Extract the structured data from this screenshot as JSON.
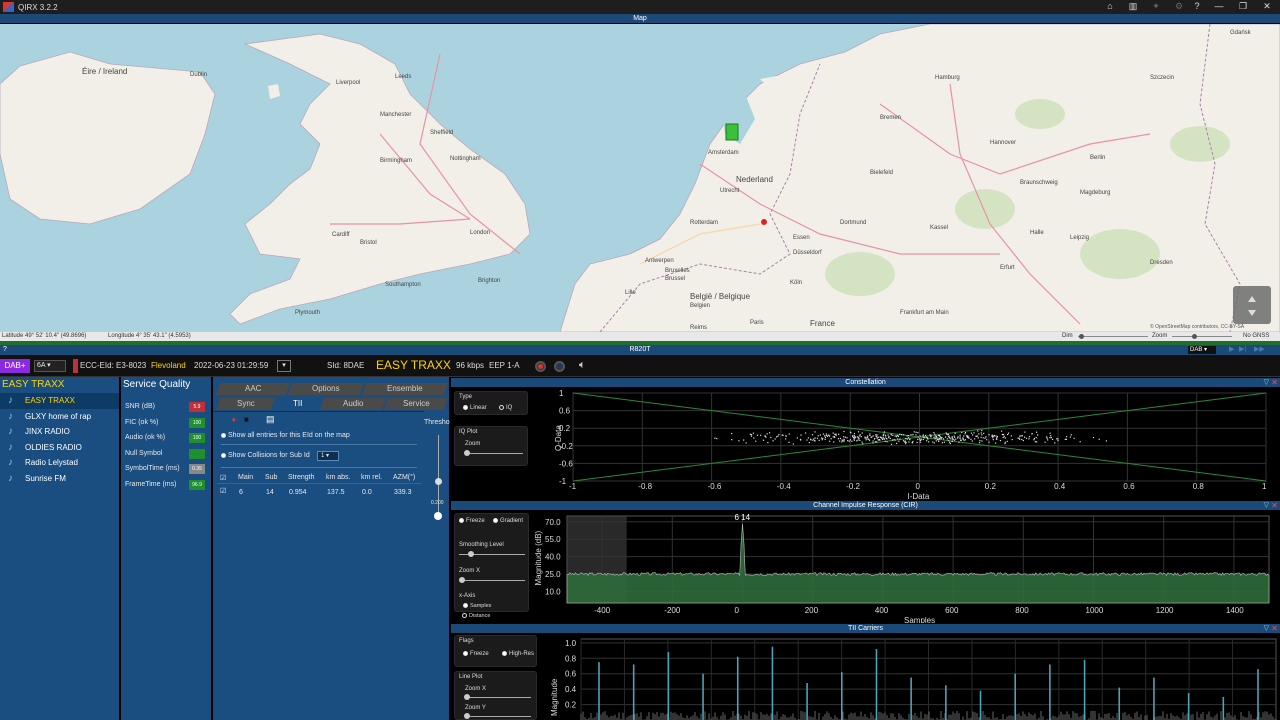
{
  "app": {
    "title": "QIRX 3.2.2"
  },
  "titlebar": {
    "icons": [
      "home-icon",
      "map-icon",
      "satellite-icon",
      "gear-icon",
      "minimize-icon",
      "maximize-icon",
      "close-icon"
    ]
  },
  "map": {
    "pane_title": "Map",
    "labels": [
      "Éire / Ireland",
      "Dublin",
      "Liverpool",
      "Leeds",
      "Manchester",
      "Sheffield",
      "Nottingham",
      "Birmingham",
      "Cardiff",
      "Bristol",
      "London",
      "Southampton",
      "Brighton",
      "Plymouth",
      "Amsterdam",
      "Nederland",
      "Utrecht",
      "Rotterdam",
      "Antwerpen",
      "Bruxelles",
      "Brussel",
      "België / Belgique",
      "Belgien",
      "Lille",
      "Essen",
      "Düsseldorf",
      "Köln",
      "Bremen",
      "Hamburg",
      "Berlin",
      "Hannover",
      "Braunschweig",
      "Magdeburg",
      "Halle",
      "Leipzig",
      "Dresden",
      "Erfurt",
      "Kassel",
      "Bielefeld",
      "Dortmund",
      "Frankfurt am Main",
      "Reims",
      "Paris",
      "France",
      "Szczecin",
      "Gdańsk"
    ],
    "latitude": "Latitude 49° 52' 10.4\" (49.8696)",
    "longitude": "Longitude 4° 35' 43.1\" (4.5953)",
    "dim_label": "Dim",
    "zoom_label": "Zoom",
    "gnss": "No GNSS",
    "attribution": "© OpenStreetMap contributors, CC-BY-SA"
  },
  "radio": {
    "bar_title": "R820T",
    "mode": "DAB",
    "cursor": "?"
  },
  "infobar": {
    "band": "DAB+",
    "channel": "6A",
    "ecc": "ECC-EId: E3-8023",
    "region": "Flevoland",
    "datetime": "2022-06-23  01:29:59",
    "sid": "SId: 8DAE",
    "service": "EASY TRAXX",
    "bitrate": "96 kbps",
    "protection": "EEP 1-A"
  },
  "stations": {
    "title": "EASY TRAXX",
    "items": [
      "EASY TRAXX",
      "GLXY home of rap",
      "JINX RADIO",
      "OLDIES RADIO",
      "Radio Lelystad",
      "Sunrise FM"
    ]
  },
  "quality": {
    "title": "Service Quality",
    "rows": [
      {
        "label": "SNR (dB)",
        "value": "5.9",
        "color": "#c0303a"
      },
      {
        "label": "FIC (ok %)",
        "value": "100",
        "color": "#1f8f2f"
      },
      {
        "label": "Audio (ok %)",
        "value": "100",
        "color": "#1f8f2f"
      },
      {
        "label": "Null Symbol",
        "value": "",
        "color": "#1f8f2f"
      },
      {
        "label": "SymbolTime (ms)",
        "value": "0.35",
        "color": "#888888"
      },
      {
        "label": "FrameTime (ms)",
        "value": "96.9",
        "color": "#1f8f2f"
      }
    ]
  },
  "tabs": {
    "row1": [
      "AAC",
      "Options",
      "Ensemble"
    ],
    "row2": [
      "Sync",
      "TII",
      "Audio",
      "Service"
    ],
    "threshold_label": "Thresho",
    "threshold_value": "0.200",
    "show_all": "Show all entries for this EId on the map",
    "show_collisions": "Show Collisions for Sub Id",
    "sub_id": "1",
    "columns": [
      "Main",
      "Sub",
      "Strength",
      "km abs.",
      "km rel.",
      "AZM(°)"
    ],
    "rows": [
      [
        "6",
        "14",
        "0.954",
        "137.5",
        "0.0",
        "339.3"
      ]
    ]
  },
  "constellation": {
    "title": "Constellation",
    "type_label": "Type",
    "linear": "Linear",
    "iq": "IQ",
    "iqplot": "IQ Plot",
    "zoom": "Zoom",
    "xlabel": "I-Data",
    "ylabel": "Q-Data",
    "xticks": [
      "-1",
      "-0.8",
      "-0.6",
      "-0.4",
      "-0.2",
      "0",
      "0.2",
      "0.4",
      "0.6",
      "0.8",
      "1"
    ],
    "yticks": [
      "1",
      "0.6",
      "0.2",
      "-0.2",
      "-0.6",
      "-1"
    ]
  },
  "cir": {
    "title": "Channel Impulse Response (CIR)",
    "freeze": "Freeze",
    "gradient": "Gradient",
    "smoothing": "Smoothing Level",
    "zoomx": "Zoom X",
    "xaxis": "x-Axis",
    "samples_opt": "Samples",
    "distance_opt": "Distance",
    "peak_label": "6 14",
    "xlabel": "Samples",
    "ylabel": "Magnitude (dB)",
    "xticks": [
      "-400",
      "-200",
      "0",
      "200",
      "400",
      "600",
      "800",
      "1000",
      "1200",
      "1400"
    ],
    "yticks": [
      "70.0",
      "55.0",
      "40.0",
      "25.0",
      "10.0"
    ]
  },
  "tii": {
    "title": "TII Carriers",
    "flags": "Flags",
    "freeze": "Freeze",
    "highres": "High-Res",
    "lineplot": "Line Plot",
    "zoomx": "Zoom X",
    "zoomy": "Zoom Y",
    "ylabel": "Magnitude",
    "yticks": [
      "1.0",
      "0.8",
      "0.6",
      "0.4",
      "0.2"
    ]
  },
  "chart_data": [
    {
      "type": "scatter",
      "title": "Constellation",
      "xlabel": "I-Data",
      "ylabel": "Q-Data",
      "xlim": [
        -1,
        1
      ],
      "ylim": [
        -1,
        1
      ],
      "x_center": 0,
      "x_spread": 0.45,
      "y_spread": 0.12
    },
    {
      "type": "line",
      "title": "Channel Impulse Response (CIR)",
      "xlabel": "Samples",
      "ylabel": "Magnitude (dB)",
      "xlim": [
        -500,
        1500
      ],
      "ylim": [
        0,
        75
      ],
      "noise_floor": 25,
      "peak": {
        "x": 0,
        "y": 68
      }
    },
    {
      "type": "bar",
      "title": "TII Carriers",
      "ylabel": "Magnitude",
      "ylim": [
        0,
        1.05
      ],
      "peaks": [
        0.75,
        0.72,
        0.88,
        0.6,
        0.82,
        0.95,
        0.48,
        0.62,
        0.92,
        0.55,
        0.45,
        0.38,
        0.6,
        0.72,
        0.78,
        0.42,
        0.55,
        0.35,
        0.3,
        0.66
      ]
    }
  ]
}
